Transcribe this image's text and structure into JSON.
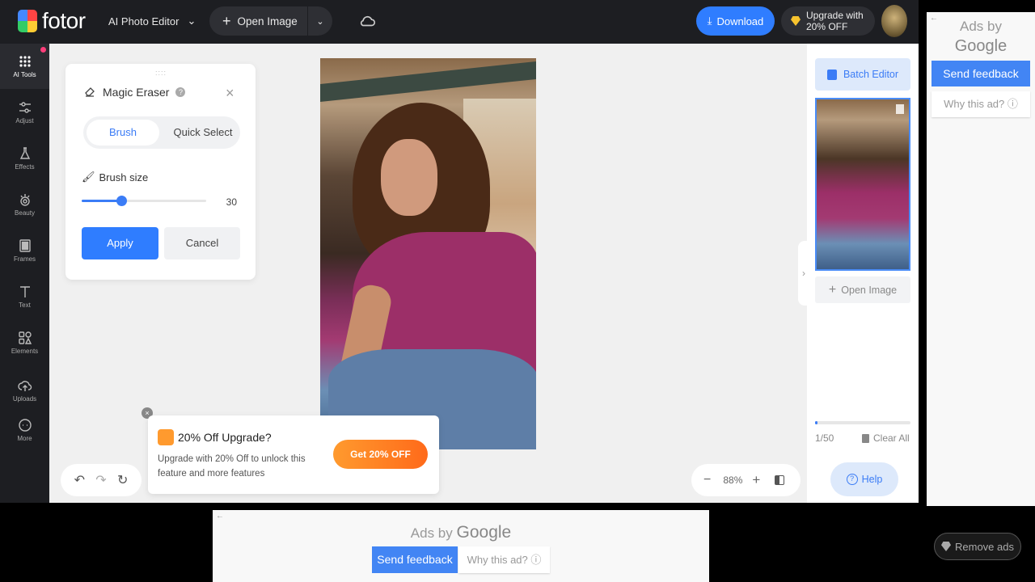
{
  "app": {
    "logo_text": "fotor",
    "editor_menu": "AI Photo Editor"
  },
  "topbar": {
    "open_image": "Open Image",
    "download": "Download",
    "upgrade_line1": "Upgrade with",
    "upgrade_line2": "20% OFF"
  },
  "sidebar": {
    "items": [
      {
        "label": "AI Tools",
        "icon": "grid-icon"
      },
      {
        "label": "Adjust",
        "icon": "sliders-icon"
      },
      {
        "label": "Effects",
        "icon": "flask-icon"
      },
      {
        "label": "Beauty",
        "icon": "eye-icon"
      },
      {
        "label": "Frames",
        "icon": "frame-icon"
      },
      {
        "label": "Text",
        "icon": "text-icon"
      },
      {
        "label": "Elements",
        "icon": "shapes-icon"
      },
      {
        "label": "Uploads",
        "icon": "upload-cloud-icon"
      },
      {
        "label": "More",
        "icon": "more-icon"
      }
    ]
  },
  "panel": {
    "drag_handle": "::::",
    "title": "Magic Eraser",
    "help": "?",
    "close": "×",
    "tabs": [
      "Brush",
      "Quick Select"
    ],
    "active_tab": "Brush",
    "brush_size_label": "Brush size",
    "brush_size_value": "30",
    "brush_size_fraction": 0.32,
    "apply": "Apply",
    "cancel": "Cancel"
  },
  "promo": {
    "close": "×",
    "title": "20% Off Upgrade?",
    "text": "Upgrade with 20% Off to unlock this feature and more features",
    "button": "Get 20% OFF"
  },
  "history": {
    "undo": "↶",
    "redo": "↷",
    "reset": "↻"
  },
  "zoom": {
    "minus": "−",
    "value": "88%",
    "plus": "+"
  },
  "right_panel": {
    "batch_editor": "Batch Editor",
    "open_image": "Open Image",
    "collapse": "›",
    "count": "1/50",
    "progress_fraction": 0.02,
    "clear_all": "Clear All",
    "help": "Help"
  },
  "ads": {
    "back": "←",
    "ads_by": "Ads by",
    "google": "Google",
    "send_feedback": "Send feedback",
    "why_this_ad": "Why this ad? ⓘ",
    "remove_ads": "Remove ads"
  },
  "colors": {
    "accent": "#2f7dff",
    "promo": "#ff8a24",
    "topbar": "#1d1e22",
    "google_blue": "#4285f4"
  }
}
